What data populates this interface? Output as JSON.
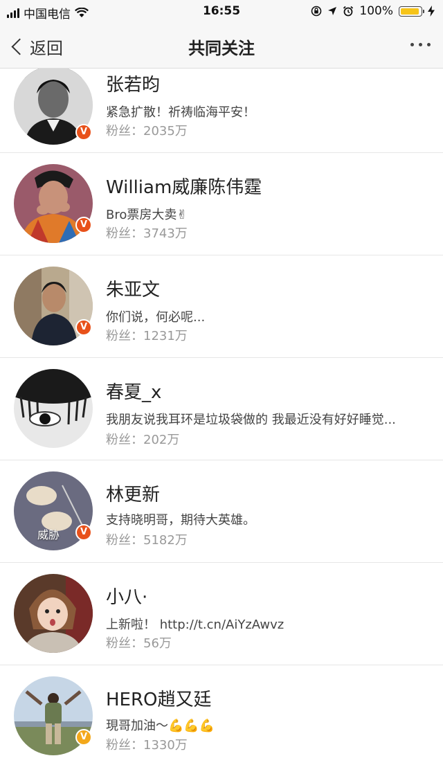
{
  "status_bar": {
    "carrier": "中国电信",
    "time": "16:55",
    "battery": "100%"
  },
  "nav": {
    "back_label": "返回",
    "title": "共同关注"
  },
  "follows": [
    {
      "name": "张若昀",
      "bio": "紧急扩散！祈祷临海平安！",
      "fans_label": "粉丝：",
      "fans": "2035万",
      "verified": "orange"
    },
    {
      "name": "William威廉陈伟霆",
      "bio": "Bro票房大卖✌",
      "fans_label": "粉丝：",
      "fans": "3743万",
      "verified": "orange"
    },
    {
      "name": "朱亚文",
      "bio": "你们说，何必呢...",
      "fans_label": "粉丝：",
      "fans": "1231万",
      "verified": "orange"
    },
    {
      "name": "春夏_x",
      "bio": "我朋友说我耳环是垃圾袋做的 我最近没有好好睡觉...",
      "fans_label": "粉丝：",
      "fans": "202万",
      "verified": ""
    },
    {
      "name": "林更新",
      "bio": "支持晓明哥，期待大英雄。",
      "fans_label": "粉丝：",
      "fans": "5182万",
      "verified": "orange",
      "avatar_text": "威胁"
    },
    {
      "name": "小八·",
      "bio": "上新啦！ http://t.cn/AiYzAwvz",
      "fans_label": "粉丝：",
      "fans": "56万",
      "verified": ""
    },
    {
      "name": "HERO趙又廷",
      "bio": "現哥加油～💪💪💪",
      "fans_label": "粉丝：",
      "fans": "1330万",
      "verified": "gold"
    }
  ],
  "colors": {
    "verified_orange": "#e8511a",
    "verified_gold": "#f3a81b",
    "battery_fill": "#f6c419"
  }
}
